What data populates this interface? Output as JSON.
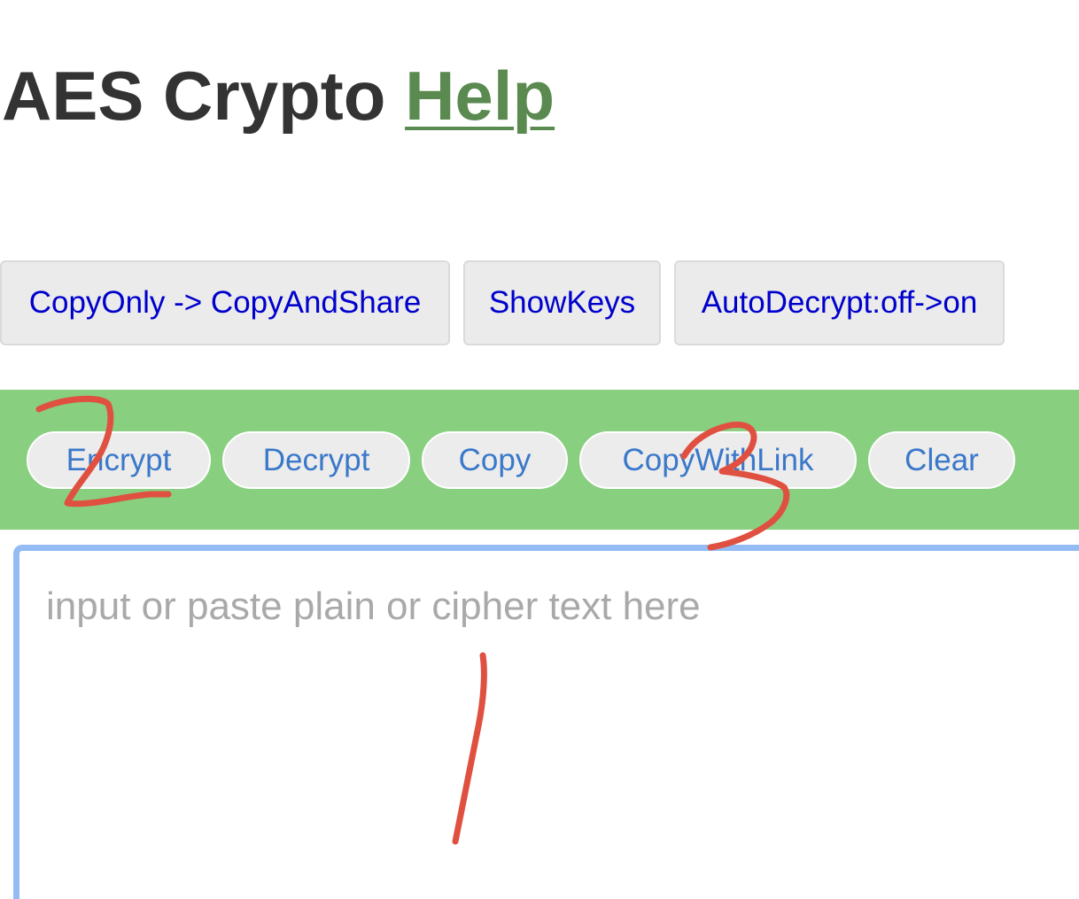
{
  "header": {
    "title": "AES Crypto",
    "help_link": "Help"
  },
  "options": [
    {
      "label": "CopyOnly -> CopyAndShare"
    },
    {
      "label": "ShowKeys"
    },
    {
      "label": "AutoDecrypt:off->on"
    }
  ],
  "toolbar": {
    "background": "#88cf7f",
    "buttons": [
      {
        "label": "Encrypt"
      },
      {
        "label": "Decrypt"
      },
      {
        "label": "Copy"
      },
      {
        "label": "CopyWithLink"
      },
      {
        "label": "Clear"
      }
    ]
  },
  "input": {
    "value": "",
    "placeholder": "input or paste plain or cipher text here"
  },
  "annotations": {
    "color": "#e05040",
    "marks": [
      {
        "label": "1",
        "target": "text input"
      },
      {
        "label": "2",
        "target": "Encrypt button"
      },
      {
        "label": "3",
        "target": "CopyWithLink button"
      }
    ]
  }
}
